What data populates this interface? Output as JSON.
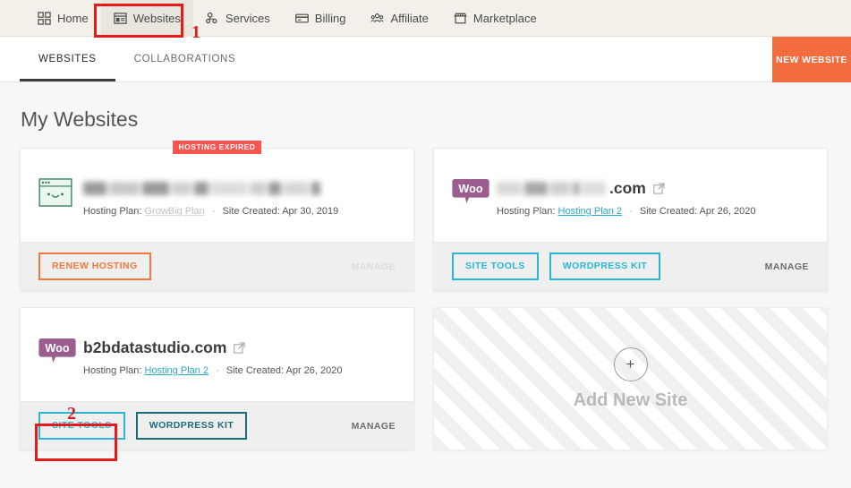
{
  "topnav": {
    "items": [
      {
        "label": "Home",
        "icon": "grid-icon",
        "active": false
      },
      {
        "label": "Websites",
        "icon": "website-icon",
        "active": true
      },
      {
        "label": "Services",
        "icon": "services-icon",
        "active": false
      },
      {
        "label": "Billing",
        "icon": "credit-card-icon",
        "active": false
      },
      {
        "label": "Affiliate",
        "icon": "affiliate-icon",
        "active": false
      },
      {
        "label": "Marketplace",
        "icon": "store-icon",
        "active": false
      }
    ]
  },
  "subbar": {
    "tabs": [
      {
        "label": "WEBSITES",
        "active": true
      },
      {
        "label": "COLLABORATIONS",
        "active": false
      }
    ],
    "new_website_label": "NEW WEBSITE"
  },
  "page": {
    "title": "My Websites"
  },
  "cards": [
    {
      "badge": "HOSTING EXPIRED",
      "logo": "green-browser-smiley-icon",
      "name_redacted": true,
      "name": "",
      "hosting_plan_label": "Hosting Plan:",
      "hosting_plan": "GrowBig Plan",
      "hosting_plan_redacted": true,
      "separator": "·",
      "site_created_label": "Site Created:",
      "site_created": "Apr 30, 2019",
      "buttons": [
        {
          "label": "RENEW HOSTING",
          "style": "orange"
        }
      ],
      "manage_label": "MANAGE",
      "manage_disabled": true
    },
    {
      "badge": "",
      "logo": "woocommerce-icon",
      "name_redacted": true,
      "name": ".com",
      "hosting_plan_label": "Hosting Plan:",
      "hosting_plan": "Hosting Plan 2",
      "hosting_plan_redacted": false,
      "separator": "·",
      "site_created_label": "Site Created:",
      "site_created": "Apr 26, 2020",
      "buttons": [
        {
          "label": "SITE TOOLS",
          "style": "teal"
        },
        {
          "label": "WORDPRESS KIT",
          "style": "teal"
        }
      ],
      "manage_label": "MANAGE",
      "manage_disabled": false
    },
    {
      "badge": "",
      "logo": "woocommerce-icon",
      "name_redacted": false,
      "name": "b2bdatastudio.com",
      "hosting_plan_label": "Hosting Plan:",
      "hosting_plan": "Hosting Plan 2",
      "hosting_plan_redacted": false,
      "separator": "·",
      "site_created_label": "Site Created:",
      "site_created": "Apr 26, 2020",
      "buttons": [
        {
          "label": "SITE TOOLS",
          "style": "teal"
        },
        {
          "label": "WORDPRESS KIT",
          "style": "teal-dark"
        }
      ],
      "manage_label": "MANAGE",
      "manage_disabled": false
    }
  ],
  "add_site": {
    "plus_glyph": "+",
    "label": "Add New Site"
  },
  "annotations": [
    {
      "number": "1",
      "target": "websites-nav-item"
    },
    {
      "number": "2",
      "target": "site-tools-button-b2bdatastudio"
    }
  ],
  "colors": {
    "accent_orange": "#f26c3d",
    "accent_teal": "#29b6d8",
    "accent_teal_dark": "#1c6b7c",
    "badge_red": "#f9544d",
    "annotation_red": "#e8191b",
    "nav_bg": "#f2f0e9",
    "page_bg": "#f7f7f7"
  }
}
